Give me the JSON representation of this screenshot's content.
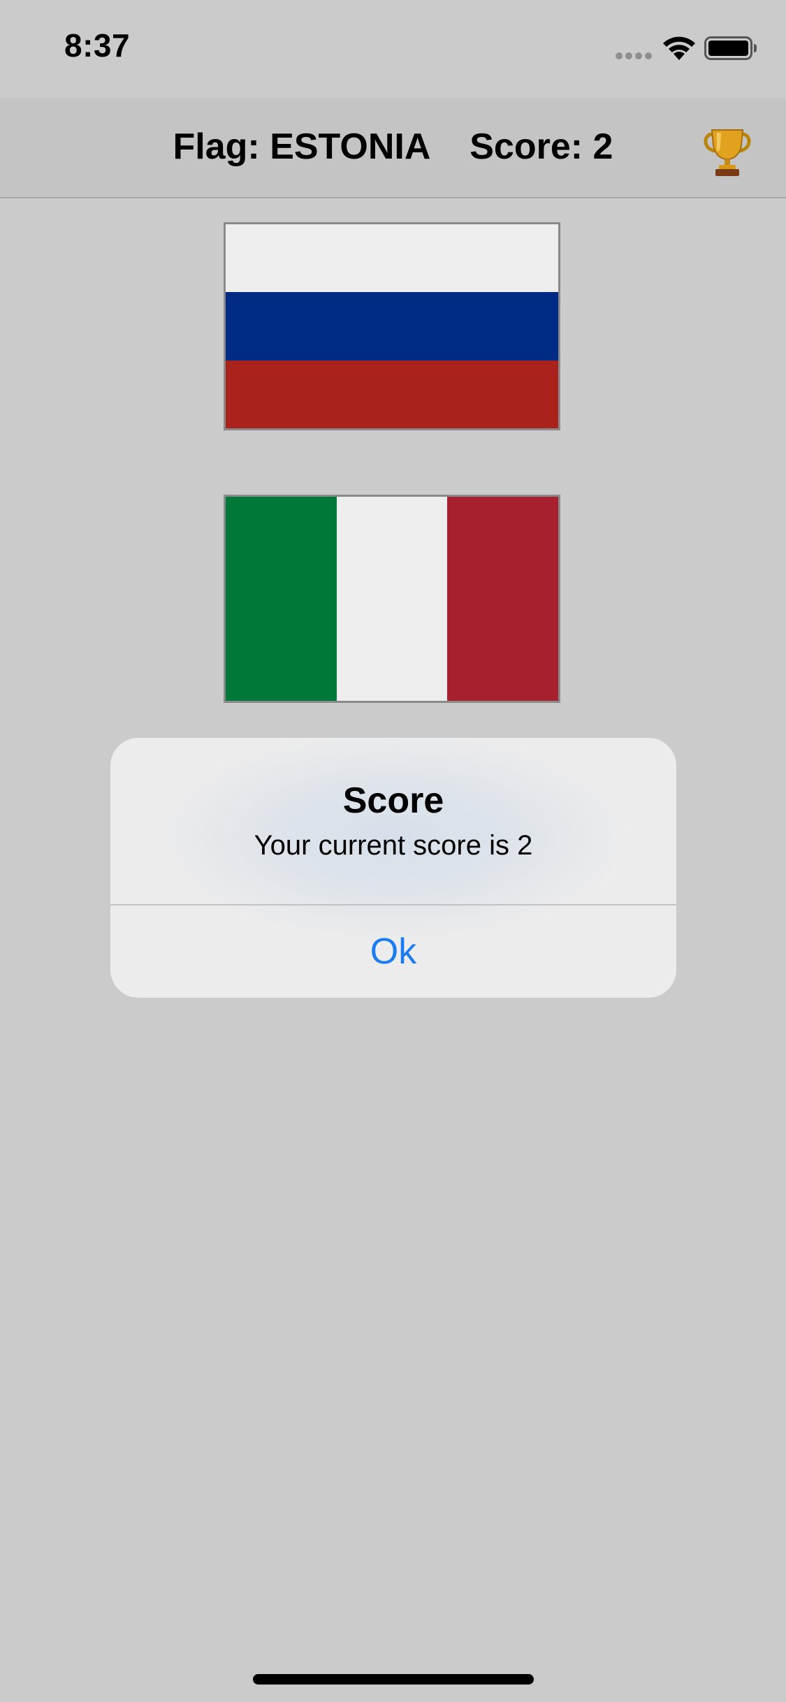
{
  "status_bar": {
    "time": "8:37",
    "icons": [
      "cellular-dots-icon",
      "wifi-icon",
      "battery-icon"
    ]
  },
  "nav": {
    "title": "Flag: ESTONIA    Score: 2",
    "trophy_icon": "trophy-icon"
  },
  "flags": [
    {
      "country": "Russia",
      "stripes": [
        "#eeeeee",
        "#002b85",
        "#a9221b"
      ],
      "orientation": "horizontal"
    },
    {
      "country": "Italy",
      "stripes": [
        "#007938",
        "#eeeeee",
        "#a6212d"
      ],
      "orientation": "vertical"
    }
  ],
  "alert": {
    "title": "Score",
    "message": "Your current score is 2",
    "button": "Ok"
  },
  "colors": {
    "background": "#cbcbcb",
    "nav_background": "#c4c4c4",
    "alert_button": "#1a7cf0"
  }
}
